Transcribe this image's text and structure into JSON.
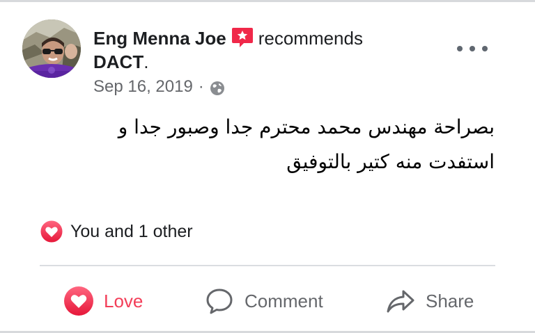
{
  "post": {
    "author_name": "Eng Menna Joe",
    "recommends_word": "recommends",
    "page_name": "DACT",
    "page_suffix": ".",
    "date": "Sep 16, 2019",
    "separator": "·",
    "text_line_1": "بصراحة مهندس محمد محترم جدا وصبور جدا و",
    "text_line_2": "استفدت منه كتير بالتوفيق",
    "audience_icon": "globe-icon",
    "recommend_icon": "recommend-badge-icon"
  },
  "reactions": {
    "icon": "heart-reaction-icon",
    "summary": "You and 1 other"
  },
  "actions": {
    "love_label": "Love",
    "comment_label": "Comment",
    "share_label": "Share"
  },
  "colors": {
    "love": "#f33e58",
    "recommend_badge": "#f02849",
    "secondary_text": "#65676b",
    "divider": "#dadde1"
  }
}
